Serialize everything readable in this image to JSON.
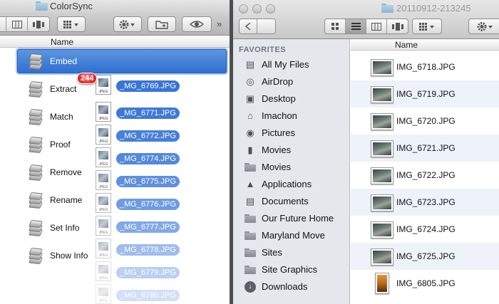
{
  "left_window": {
    "title": "ColorSync",
    "toolbar": {
      "more": "»"
    },
    "column_header": "Name",
    "actions": [
      {
        "label": "Embed",
        "selected": true
      },
      {
        "label": "Extract"
      },
      {
        "label": "Match"
      },
      {
        "label": "Proof"
      },
      {
        "label": "Remove"
      },
      {
        "label": "Rename"
      },
      {
        "label": "Set Info"
      },
      {
        "label": "Show Info"
      }
    ]
  },
  "drag": {
    "count_badge": "244",
    "file_type": "JPEG",
    "items": [
      "_MG_6769.JPG",
      "_MG_6771.JPG",
      "_MG_6772.JPG",
      "_MG_6774.JPG",
      "_MG_6775.JPG",
      "_MG_6776.JPG",
      "_MG_6777.JPG",
      "_MG_6778.JPG",
      "_MG_6779.JPG",
      "_MG_6780.JPG"
    ]
  },
  "right_window": {
    "title": "20110912-213245",
    "sidebar": {
      "heading": "FAVORITES",
      "items": [
        {
          "label": "All My Files",
          "icon": "all-files-icon"
        },
        {
          "label": "AirDrop",
          "icon": "airdrop-icon"
        },
        {
          "label": "Desktop",
          "icon": "desktop-icon"
        },
        {
          "label": "Imachon",
          "icon": "home-icon"
        },
        {
          "label": "Pictures",
          "icon": "camera-icon"
        },
        {
          "label": "Movies",
          "icon": "film-icon"
        },
        {
          "label": "Movies",
          "icon": "folder-icon"
        },
        {
          "label": "Applications",
          "icon": "applications-icon"
        },
        {
          "label": "Documents",
          "icon": "documents-icon"
        },
        {
          "label": "Our Future Home",
          "icon": "folder-icon"
        },
        {
          "label": "Maryland Move",
          "icon": "folder-icon"
        },
        {
          "label": "Sites",
          "icon": "folder-icon"
        },
        {
          "label": "Site Graphics",
          "icon": "folder-icon"
        },
        {
          "label": "Downloads",
          "icon": "downloads-icon"
        }
      ]
    },
    "column_header": "Name",
    "files": [
      "IMG_6718.JPG",
      "IMG_6719.JPG",
      "IMG_6720.JPG",
      "IMG_6721.JPG",
      "IMG_6722.JPG",
      "IMG_6723.JPG",
      "IMG_6724.JPG",
      "IMG_6725.JPG",
      "IMG_6805.JPG"
    ]
  },
  "colors": {
    "selection": "#3875d7",
    "badge": "#d30000",
    "sidebar_bg": "#e4e7ec"
  }
}
